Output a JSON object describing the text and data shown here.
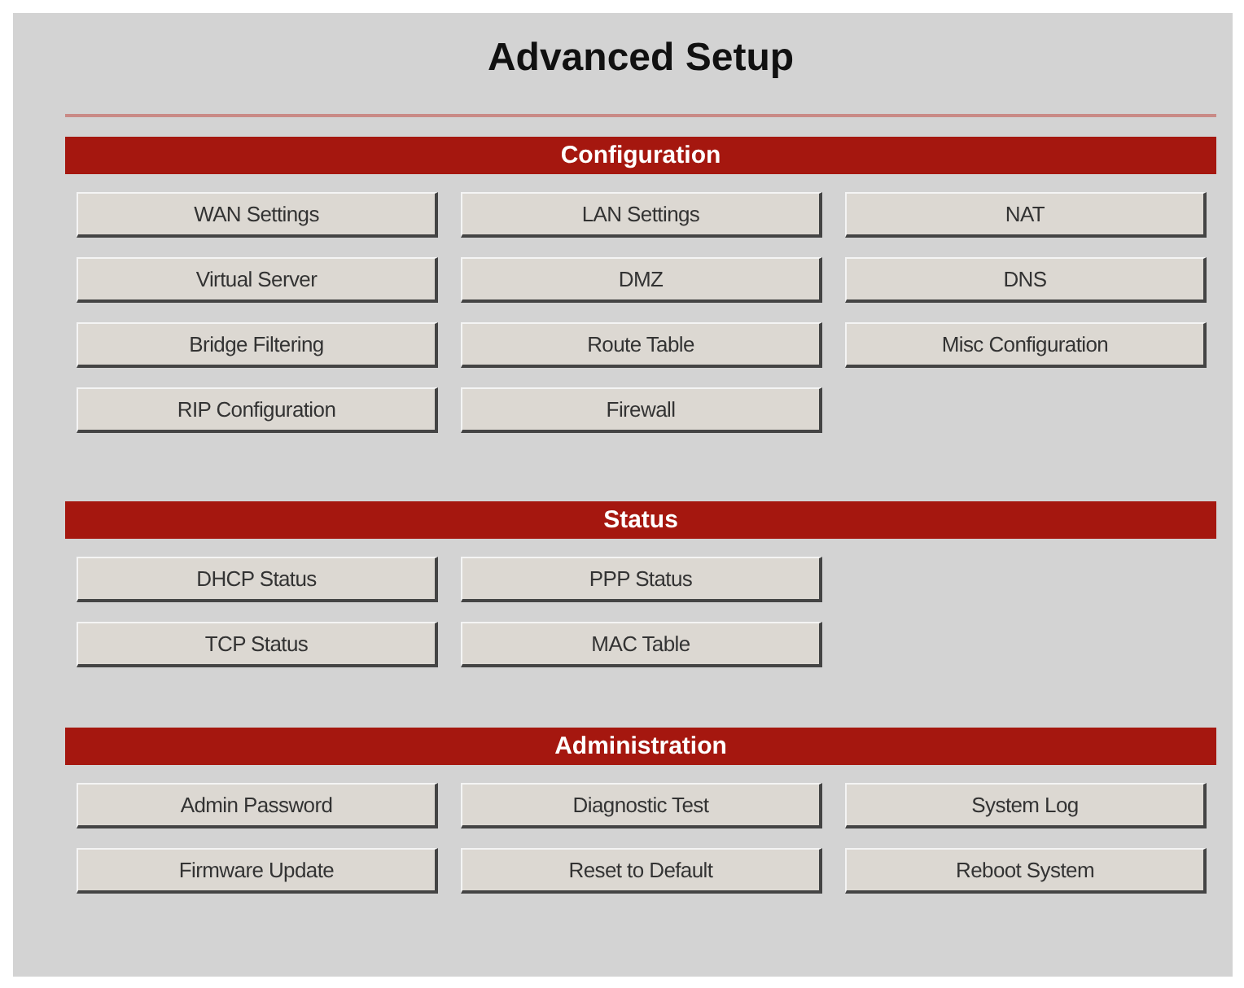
{
  "title": "Advanced Setup",
  "sections": [
    {
      "heading": "Configuration",
      "rows": [
        [
          "WAN Settings",
          "LAN Settings",
          "NAT"
        ],
        [
          "Virtual Server",
          "DMZ",
          "DNS"
        ],
        [
          "Bridge Filtering",
          "Route Table",
          "Misc Configuration"
        ],
        [
          "RIP Configuration",
          "Firewall"
        ]
      ]
    },
    {
      "heading": "Status",
      "rows": [
        [
          "DHCP Status",
          "PPP Status"
        ],
        [
          "TCP Status",
          "MAC Table"
        ]
      ]
    },
    {
      "heading": "Administration",
      "rows": [
        [
          "Admin Password",
          "Diagnostic Test",
          "System Log"
        ],
        [
          "Firmware Update",
          "Reset to Default",
          "Reboot System"
        ]
      ]
    }
  ]
}
